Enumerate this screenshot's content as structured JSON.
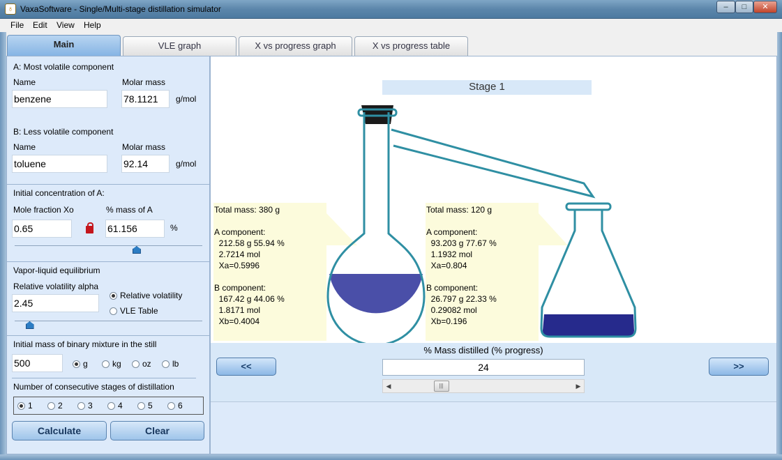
{
  "window": {
    "title": "VaxaSoftware - Single/Multi-stage distillation simulator",
    "minimize": "–",
    "maximize": "□",
    "close": "✕"
  },
  "menu": [
    "File",
    "Edit",
    "View",
    "Help"
  ],
  "tabs": [
    "Main",
    "VLE graph",
    "X vs progress graph",
    "X vs progress table"
  ],
  "component_a": {
    "heading": "A: Most volatile component",
    "name_label": "Name",
    "molar_label": "Molar mass",
    "name": "benzene",
    "molar_mass": "78.1121",
    "unit": "g/mol"
  },
  "component_b": {
    "heading": "B: Less volatile component",
    "name_label": "Name",
    "molar_label": "Molar mass",
    "name": "toluene",
    "molar_mass": "92.14",
    "unit": "g/mol"
  },
  "concentration": {
    "heading": "Initial concentration of A:",
    "mole_label": "Mole fraction Xo",
    "mass_label": "% mass of A",
    "mole_fraction": "0.65",
    "mass_percent": "61.156",
    "unit": "%",
    "slider_level": 0.65
  },
  "vle": {
    "heading": "Vapor-liquid equilibrium",
    "alpha_label": "Relative volatility alpha",
    "alpha": "2.45",
    "options": [
      "Relative volatility",
      "VLE Table"
    ],
    "selected": "Relative volatility",
    "slider_level": 0.08
  },
  "mass": {
    "heading": "Initial mass of binary mixture in the still",
    "value": "500",
    "units": [
      "g",
      "kg",
      "oz",
      "lb"
    ],
    "selected_unit": "g"
  },
  "stages": {
    "heading": "Number of consecutive stages of distillation",
    "options": [
      "1",
      "2",
      "3",
      "4",
      "5",
      "6"
    ],
    "selected": "1"
  },
  "buttons": {
    "calculate": "Calculate",
    "clear": "Clear"
  },
  "simulation": {
    "stage_title": "Stage 1",
    "still_info": "Total mass: 380 g\n\nA component:\n  212.58 g 55.94 %\n  2.7214 mol\n  Xa=0.5996\n\nB component:\n  167.42 g 44.06 %\n  1.8171 mol\n  Xb=0.4004",
    "receiver_info": "Total mass: 120 g\n\nA component:\n  93.203 g 77.67 %\n  1.1932 mol\n  Xa=0.804\n\nB component:\n  26.797 g 22.33 %\n  0.29082 mol\n  Xb=0.196",
    "progress_label": "% Mass distilled (% progress)",
    "progress_value": "24",
    "prev": "<<",
    "next": ">>",
    "still_liquid_color": "#4a4fa8",
    "receiver_liquid_color": "#262a8c",
    "glass_color": "#2f8fa3"
  }
}
